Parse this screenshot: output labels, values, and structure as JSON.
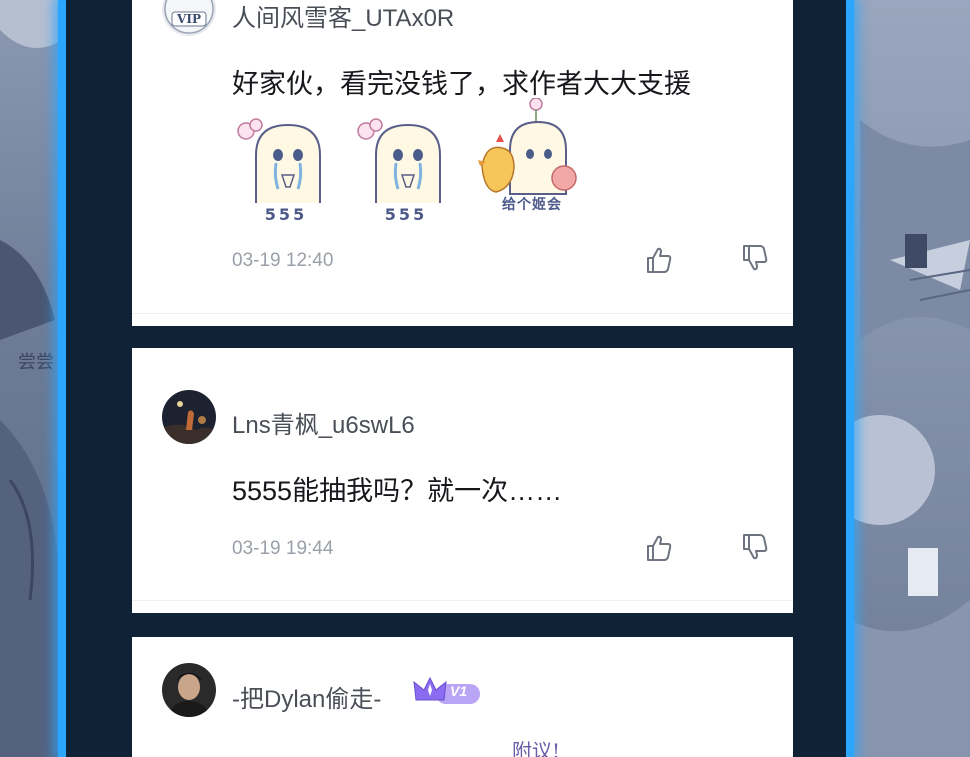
{
  "comments": [
    {
      "username": "人间风雪客_UTAx0R",
      "avatar_badge": "VIP",
      "text": "好家伙，看完没钱了，求作者大大支援",
      "stickers": [
        {
          "name": "crying-ghost-sticker",
          "label": "555"
        },
        {
          "name": "crying-ghost-sticker",
          "label": "555"
        },
        {
          "name": "chicken-chick-sticker",
          "label": "给个姬会"
        }
      ],
      "time": "03-19 12:40"
    },
    {
      "username": "Lns青枫_u6swL6",
      "text": "5555能抽我吗？就一次……",
      "time": "03-19 19:44"
    },
    {
      "username": "-把Dylan偷走-",
      "level_badge": "V1",
      "partial_text": "附议!"
    }
  ],
  "icons": {
    "like": "thumb-up-icon",
    "dislike": "thumb-down-icon"
  },
  "colors": {
    "accent_glow": "#2aa6ff",
    "username": "#4a4f57",
    "time": "#9aa0a8",
    "badge_purple": "#8b6cf0"
  }
}
